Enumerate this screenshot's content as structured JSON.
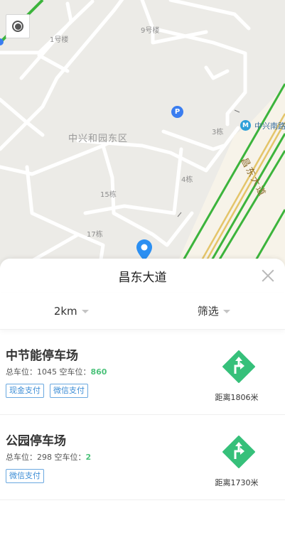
{
  "map": {
    "labels": {
      "bldg_1": "1号楼",
      "bldg_9": "9号楼",
      "district": "中兴和园东区",
      "bldg_3": "3栋",
      "bldg_4": "4栋",
      "bldg_15": "15栋",
      "bldg_17": "17栋",
      "metro_station": "中兴南路",
      "road": "昌东大道"
    },
    "parking_marker": "P",
    "metro_marker": "M",
    "colors": {
      "land": "#ecebe7",
      "road": "#ffffff",
      "highway": "#3cb43c",
      "accent": "#3a7df0"
    }
  },
  "sheet": {
    "title": "昌东大道",
    "filters": {
      "distance": "2km",
      "filter": "筛选"
    }
  },
  "parking_lots": [
    {
      "name": "中节能停车场",
      "total_label": "总车位：",
      "total": "1045",
      "free_label": " 空车位：",
      "free": "860",
      "tags": [
        "现金支付",
        "微信支付"
      ],
      "distance": "距离1806米"
    },
    {
      "name": "公园停车场",
      "total_label": "总车位：",
      "total": "298",
      "free_label": " 空车位：",
      "free": "2",
      "tags": [
        "微信支付"
      ],
      "distance": "距离1730米"
    }
  ],
  "icons": {
    "locate": "locate-icon",
    "close": "close-icon",
    "navigate": "navigate-turn-icon",
    "pin": "map-pin-icon"
  }
}
